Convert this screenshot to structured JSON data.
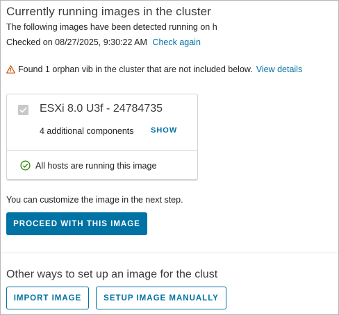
{
  "header": {
    "title": "Currently running images in the cluster",
    "description": "The following images have been detected running on h",
    "checked_on": "Checked on 08/27/2025, 9:30:22 AM",
    "check_again_label": "Check again"
  },
  "warning": {
    "message": "Found 1 orphan vib in the cluster that are not included below.",
    "link_label": "View details",
    "color": "#c25400"
  },
  "image_card": {
    "name": "ESXi 8.0 U3f - 24784735",
    "components": "4 additional components",
    "show_label": "SHOW",
    "status": "All hosts are running this image",
    "status_color": "#2f8400"
  },
  "customize_note": "You can customize the image in the next step.",
  "proceed_label": "PROCEED WITH THIS IMAGE",
  "other_ways": {
    "title": "Other ways to set up an image for the clust",
    "import_label": "IMPORT IMAGE",
    "setup_label": "SETUP IMAGE MANUALLY"
  },
  "colors": {
    "accent": "#0072a3"
  }
}
